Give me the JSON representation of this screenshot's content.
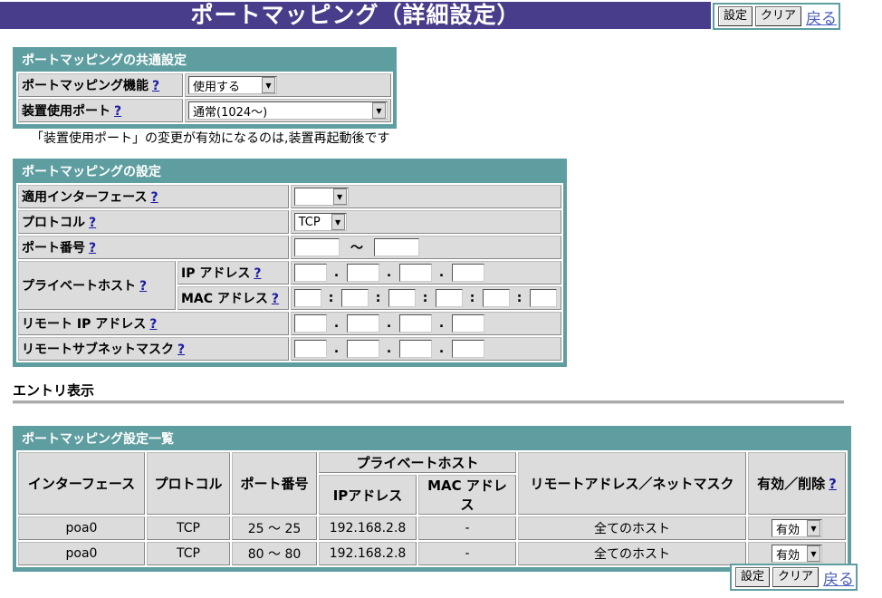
{
  "page": {
    "title": "ポートマッピング（詳細設定）",
    "buttons": {
      "set": "設定",
      "clear": "クリア",
      "back": "戻る"
    },
    "help_mark": "?"
  },
  "common": {
    "heading": "ポートマッピングの共通設定",
    "function_label": "ポートマッピング機能",
    "function_value": "使用する",
    "port_label": "装置使用ポート",
    "port_value": "通常(1024～)",
    "note": "「装置使用ポート」の変更が有効になるのは,装置再起動後です"
  },
  "settings": {
    "heading": "ポートマッピングの設定",
    "interface_label": "適用インターフェース",
    "interface_value": "",
    "protocol_label": "プロトコル",
    "protocol_value": "TCP",
    "port_label": "ポート番号",
    "port_tilde": "～",
    "private_host_label": "プライベートホスト",
    "ip_label": "IP アドレス",
    "mac_label": "MAC アドレス",
    "remote_ip_label": "リモート IP アドレス",
    "remote_mask_label": "リモートサブネットマスク",
    "dot": ".",
    "colon": ":"
  },
  "entry": {
    "heading": "エントリ表示"
  },
  "list": {
    "heading": "ポートマッピング設定一覧",
    "headers": {
      "interface": "インターフェース",
      "protocol": "プロトコル",
      "port": "ポート番号",
      "private_host": "プライベートホスト",
      "ip": "IPアドレス",
      "mac": "MAC アドレス",
      "remote": "リモートアドレス／ネットマスク",
      "enabled": "有効／削除"
    },
    "rows": [
      {
        "interface": "poa0",
        "protocol": "TCP",
        "port": "25 ～ 25",
        "ip": "192.168.2.8",
        "mac": "-",
        "remote": "全てのホスト",
        "enabled": "有効"
      },
      {
        "interface": "poa0",
        "protocol": "TCP",
        "port": "80 ～ 80",
        "ip": "192.168.2.8",
        "mac": "-",
        "remote": "全てのホスト",
        "enabled": "有効"
      }
    ]
  },
  "colors": {
    "title_bg": "#483d8b",
    "panel": "#5f9ea0",
    "cell": "#dcdcdc",
    "link": "#1a1aa6"
  }
}
